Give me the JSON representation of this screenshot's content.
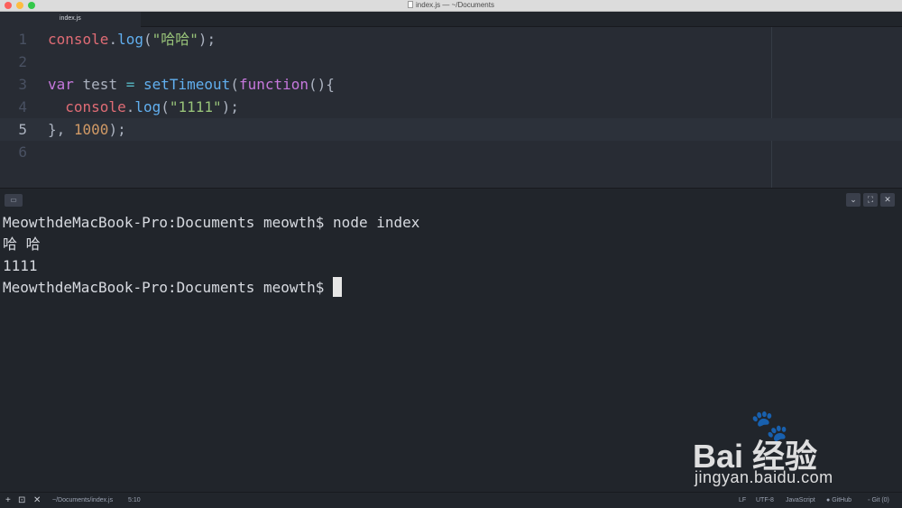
{
  "window": {
    "title": "index.js — ~/Documents"
  },
  "tabs": [
    {
      "label": "index.js"
    }
  ],
  "editor": {
    "lines": [
      {
        "number": "1",
        "tokens": [
          {
            "text": "console",
            "color": "red"
          },
          {
            "text": ".",
            "color": "plain"
          },
          {
            "text": "log",
            "color": "blue"
          },
          {
            "text": "(",
            "color": "plain"
          },
          {
            "text": "\"哈哈\"",
            "color": "green"
          },
          {
            "text": ");",
            "color": "plain"
          }
        ]
      },
      {
        "number": "2",
        "tokens": []
      },
      {
        "number": "3",
        "tokens": [
          {
            "text": "var",
            "color": "purple"
          },
          {
            "text": " test ",
            "color": "plain"
          },
          {
            "text": "=",
            "color": "cyan"
          },
          {
            "text": " ",
            "color": "plain"
          },
          {
            "text": "setTimeout",
            "color": "blue"
          },
          {
            "text": "(",
            "color": "plain"
          },
          {
            "text": "function",
            "color": "purple"
          },
          {
            "text": "(){",
            "color": "plain"
          }
        ]
      },
      {
        "number": "4",
        "tokens": [
          {
            "text": "  console",
            "color": "red"
          },
          {
            "text": ".",
            "color": "plain"
          },
          {
            "text": "log",
            "color": "blue"
          },
          {
            "text": "(",
            "color": "plain"
          },
          {
            "text": "\"1111\"",
            "color": "green"
          },
          {
            "text": ");",
            "color": "plain"
          }
        ]
      },
      {
        "number": "5",
        "tokens": [
          {
            "text": "}, ",
            "color": "plain"
          },
          {
            "text": "1000",
            "color": "orange"
          },
          {
            "text": ");",
            "color": "plain"
          }
        ]
      },
      {
        "number": "6",
        "tokens": []
      }
    ],
    "current_line": "5"
  },
  "terminal": {
    "lines": [
      "MeowthdeMacBook-Pro:Documents meowth$ node index",
      "哈 哈",
      "1111",
      "MeowthdeMacBook-Pro:Documents meowth$ "
    ],
    "buttons": {
      "collapse": "⌄",
      "maximize": "⛶",
      "close": "✕"
    }
  },
  "statusbar": {
    "file_path": "~/Documents/index.js",
    "cursor_position": "5:10",
    "line_ending": "LF",
    "encoding": "UTF-8",
    "grammar": "JavaScript",
    "github": "GitHub",
    "git": "Git (0)"
  },
  "watermark": {
    "brand": "Bai  经验",
    "url": "jingyan.baidu.com"
  },
  "colors": {
    "red": "#e06c75",
    "blue": "#61afef",
    "green": "#98c379",
    "purple": "#c678dd",
    "orange": "#d19a66",
    "cyan": "#56b6c2",
    "plain": "#abb2bf"
  }
}
